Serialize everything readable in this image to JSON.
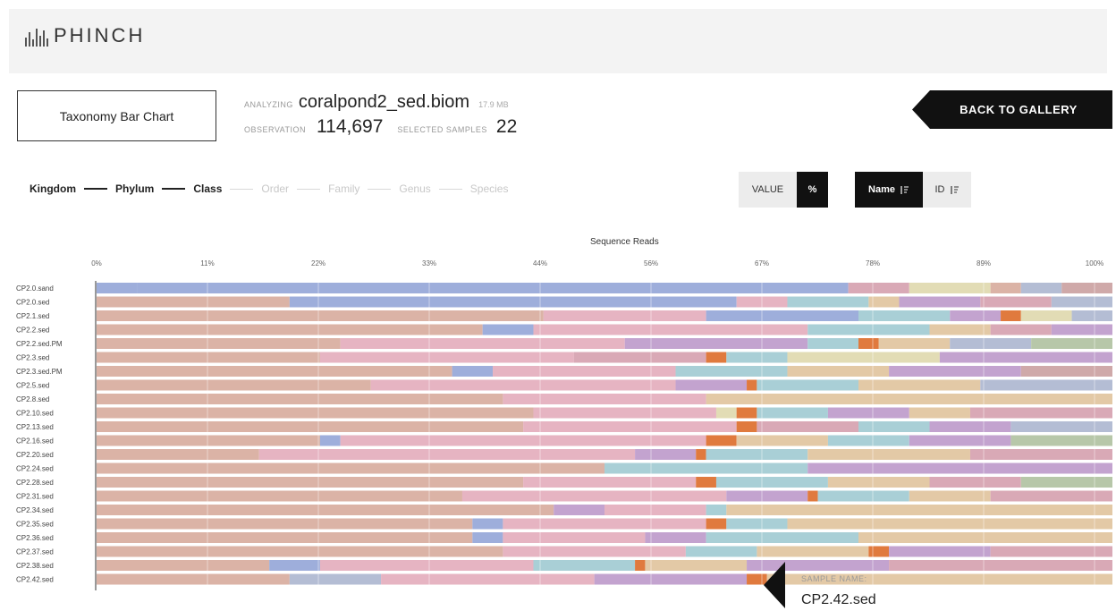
{
  "app": {
    "name": "PHINCH",
    "logo_icon": "phinch-logo-icon"
  },
  "viz_selector": {
    "label": "Taxonomy Bar Chart"
  },
  "file_info": {
    "analyzing_label": "ANALYZING",
    "filename": "coralpond2_sed.biom",
    "filesize": "17.9 MB",
    "observation_label": "OBSERVATION",
    "observation_count": "114,697",
    "selected_label": "SELECTED SAMPLES",
    "selected_count": "22"
  },
  "back_button": {
    "label": "BACK TO GALLERY",
    "color": "#111111"
  },
  "taxonomy_levels": [
    {
      "label": "Kingdom",
      "active": true
    },
    {
      "label": "Phylum",
      "active": true
    },
    {
      "label": "Class",
      "active": true
    },
    {
      "label": "Order",
      "active": false
    },
    {
      "label": "Family",
      "active": false
    },
    {
      "label": "Genus",
      "active": false
    },
    {
      "label": "Species",
      "active": false
    }
  ],
  "value_toggle": {
    "label": "VALUE",
    "selected": "%"
  },
  "sort_toggle": {
    "name": "Name",
    "id": "ID",
    "selected": "Name",
    "icon": "sort-icon"
  },
  "chart_data": {
    "type": "bar",
    "orientation": "horizontal",
    "stacked": true,
    "title": "Sequence Reads",
    "x_ticks": [
      "0%",
      "11%",
      "22%",
      "33%",
      "44%",
      "56%",
      "67%",
      "78%",
      "89%",
      "100%"
    ],
    "xlim": [
      0,
      100
    ],
    "categories": [
      "CP2.0.sand",
      "CP2.0.sed",
      "CP2.1.sed",
      "CP2.2.sed",
      "CP2.2.sed.PM",
      "CP2.3.sed",
      "CP2.3.sed.PM",
      "CP2.5.sed",
      "CP2.8.sed",
      "CP2.10.sed",
      "CP2.13.sed",
      "CP2.16.sed",
      "CP2.20.sed",
      "CP2.24.sed",
      "CP2.28.sed",
      "CP2.31.sed",
      "CP2.34.sed",
      "CP2.35.sed",
      "CP2.36.sed",
      "CP2.37.sed",
      "CP2.38.sed",
      "CP2.42.sed"
    ],
    "palette": [
      "#9eaedb",
      "#dbb3a6",
      "#e6b4c2",
      "#a9cfd6",
      "#e3c9a6",
      "#c3a3cf",
      "#d9a9b6",
      "#b7c7a9",
      "#e2dcb5",
      "#e07a3e",
      "#b4bdd4",
      "#cfa9a9"
    ],
    "rows": [
      [
        [
          0,
          4,
          0
        ],
        [
          4,
          74,
          0
        ],
        [
          74,
          80,
          6
        ],
        [
          80,
          88,
          8
        ],
        [
          88,
          91,
          1
        ],
        [
          91,
          95,
          10
        ],
        [
          95,
          100,
          11
        ]
      ],
      [
        [
          0,
          19,
          1
        ],
        [
          19,
          63,
          0
        ],
        [
          63,
          68,
          2
        ],
        [
          68,
          76,
          3
        ],
        [
          76,
          79,
          4
        ],
        [
          79,
          87,
          5
        ],
        [
          87,
          94,
          6
        ],
        [
          94,
          100,
          10
        ]
      ],
      [
        [
          0,
          44,
          1
        ],
        [
          44,
          60,
          2
        ],
        [
          60,
          75,
          0
        ],
        [
          75,
          84,
          3
        ],
        [
          84,
          89,
          5
        ],
        [
          89,
          91,
          9
        ],
        [
          91,
          96,
          8
        ],
        [
          96,
          100,
          10
        ]
      ],
      [
        [
          0,
          38,
          1
        ],
        [
          38,
          43,
          0
        ],
        [
          43,
          70,
          2
        ],
        [
          70,
          82,
          3
        ],
        [
          82,
          88,
          4
        ],
        [
          88,
          94,
          6
        ],
        [
          94,
          100,
          5
        ]
      ],
      [
        [
          0,
          24,
          1
        ],
        [
          24,
          52,
          2
        ],
        [
          52,
          70,
          5
        ],
        [
          70,
          75,
          3
        ],
        [
          75,
          77,
          9
        ],
        [
          77,
          84,
          4
        ],
        [
          84,
          92,
          10
        ],
        [
          92,
          100,
          7
        ]
      ],
      [
        [
          0,
          22,
          1
        ],
        [
          22,
          47,
          2
        ],
        [
          47,
          60,
          6
        ],
        [
          60,
          62,
          9
        ],
        [
          62,
          68,
          3
        ],
        [
          68,
          83,
          8
        ],
        [
          83,
          100,
          5
        ]
      ],
      [
        [
          0,
          35,
          1
        ],
        [
          35,
          39,
          0
        ],
        [
          39,
          57,
          2
        ],
        [
          57,
          68,
          3
        ],
        [
          68,
          78,
          4
        ],
        [
          78,
          91,
          5
        ],
        [
          91,
          100,
          11
        ]
      ],
      [
        [
          0,
          27,
          1
        ],
        [
          27,
          57,
          2
        ],
        [
          57,
          64,
          5
        ],
        [
          64,
          65,
          9
        ],
        [
          65,
          75,
          3
        ],
        [
          75,
          87,
          4
        ],
        [
          87,
          100,
          10
        ]
      ],
      [
        [
          0,
          40,
          1
        ],
        [
          40,
          60,
          2
        ],
        [
          60,
          100,
          4
        ]
      ],
      [
        [
          0,
          43,
          1
        ],
        [
          43,
          61,
          2
        ],
        [
          61,
          63,
          8
        ],
        [
          63,
          65,
          9
        ],
        [
          65,
          72,
          3
        ],
        [
          72,
          80,
          5
        ],
        [
          80,
          86,
          4
        ],
        [
          86,
          100,
          6
        ]
      ],
      [
        [
          0,
          42,
          1
        ],
        [
          42,
          63,
          2
        ],
        [
          63,
          65,
          9
        ],
        [
          65,
          75,
          6
        ],
        [
          75,
          82,
          3
        ],
        [
          82,
          90,
          5
        ],
        [
          90,
          100,
          10
        ]
      ],
      [
        [
          0,
          22,
          1
        ],
        [
          22,
          24,
          0
        ],
        [
          24,
          60,
          2
        ],
        [
          60,
          63,
          9
        ],
        [
          63,
          72,
          4
        ],
        [
          72,
          80,
          3
        ],
        [
          80,
          90,
          5
        ],
        [
          90,
          100,
          7
        ]
      ],
      [
        [
          0,
          16,
          1
        ],
        [
          16,
          53,
          2
        ],
        [
          53,
          59,
          5
        ],
        [
          59,
          60,
          9
        ],
        [
          60,
          70,
          3
        ],
        [
          70,
          86,
          4
        ],
        [
          86,
          100,
          6
        ]
      ],
      [
        [
          0,
          50,
          1
        ],
        [
          50,
          70,
          3
        ],
        [
          70,
          100,
          5
        ]
      ],
      [
        [
          0,
          42,
          1
        ],
        [
          42,
          59,
          2
        ],
        [
          59,
          61,
          9
        ],
        [
          61,
          72,
          3
        ],
        [
          72,
          82,
          4
        ],
        [
          82,
          91,
          6
        ],
        [
          91,
          100,
          7
        ]
      ],
      [
        [
          0,
          36,
          1
        ],
        [
          36,
          62,
          2
        ],
        [
          62,
          70,
          5
        ],
        [
          70,
          71,
          9
        ],
        [
          71,
          80,
          3
        ],
        [
          80,
          88,
          4
        ],
        [
          88,
          100,
          6
        ]
      ],
      [
        [
          0,
          45,
          1
        ],
        [
          45,
          50,
          5
        ],
        [
          50,
          60,
          2
        ],
        [
          60,
          62,
          3
        ],
        [
          62,
          100,
          4
        ]
      ],
      [
        [
          0,
          37,
          1
        ],
        [
          37,
          40,
          0
        ],
        [
          40,
          60,
          2
        ],
        [
          60,
          62,
          9
        ],
        [
          62,
          68,
          3
        ],
        [
          68,
          100,
          4
        ]
      ],
      [
        [
          0,
          37,
          1
        ],
        [
          37,
          40,
          0
        ],
        [
          40,
          54,
          2
        ],
        [
          54,
          60,
          5
        ],
        [
          60,
          75,
          3
        ],
        [
          75,
          100,
          4
        ]
      ],
      [
        [
          0,
          40,
          1
        ],
        [
          40,
          58,
          2
        ],
        [
          58,
          65,
          3
        ],
        [
          65,
          76,
          4
        ],
        [
          76,
          78,
          9
        ],
        [
          78,
          88,
          5
        ],
        [
          88,
          100,
          6
        ]
      ],
      [
        [
          0,
          17,
          1
        ],
        [
          17,
          22,
          0
        ],
        [
          22,
          43,
          2
        ],
        [
          43,
          53,
          3
        ],
        [
          53,
          54,
          9
        ],
        [
          54,
          64,
          4
        ],
        [
          64,
          78,
          5
        ],
        [
          78,
          100,
          6
        ]
      ],
      [
        [
          0,
          19,
          1
        ],
        [
          19,
          28,
          10
        ],
        [
          28,
          49,
          2
        ],
        [
          49,
          64,
          5
        ],
        [
          64,
          66,
          9
        ],
        [
          66,
          100,
          4
        ]
      ]
    ]
  },
  "tooltip": {
    "label": "SAMPLE NAME:",
    "value": "CP2.42.sed"
  }
}
